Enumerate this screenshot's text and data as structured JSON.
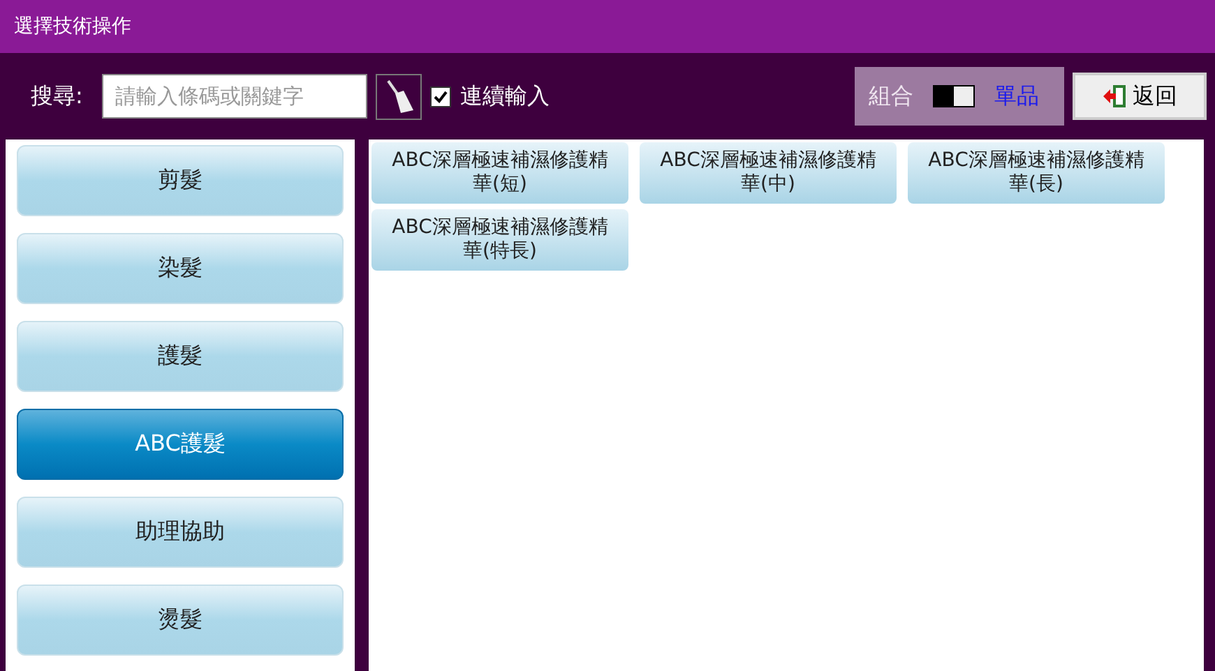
{
  "window": {
    "title": "選擇技術操作"
  },
  "search": {
    "label": "搜尋:",
    "placeholder": "請輸入條碼或關鍵字"
  },
  "continuous_input": {
    "label": "連續輸入",
    "checked": true
  },
  "mode_toggle": {
    "on": false,
    "options": [
      {
        "label": "組合",
        "selected": false
      },
      {
        "label": "單品",
        "selected": true
      }
    ]
  },
  "back_button": {
    "label": "返回"
  },
  "categories": [
    {
      "label": "剪髮",
      "selected": false
    },
    {
      "label": "染髮",
      "selected": false
    },
    {
      "label": "護髮",
      "selected": false
    },
    {
      "label": "ABC護髮",
      "selected": true
    },
    {
      "label": "助理協助",
      "selected": false
    },
    {
      "label": "燙髮",
      "selected": false
    }
  ],
  "services": [
    {
      "label": "ABC深層極速補濕修護精華(短)"
    },
    {
      "label": "ABC深層極速補濕修護精華(中)"
    },
    {
      "label": "ABC深層極速補濕修護精華(長)"
    },
    {
      "label": "ABC深層極速補濕修護精華(特長)"
    }
  ]
}
